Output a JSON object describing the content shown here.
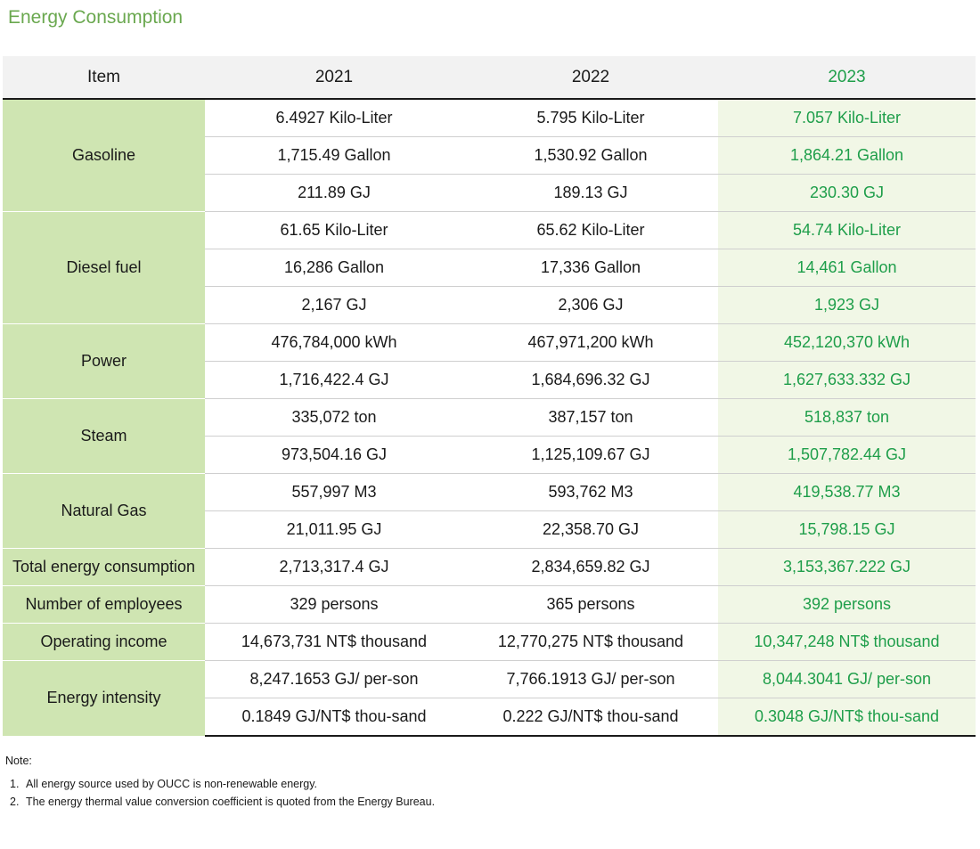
{
  "title": "Energy Consumption",
  "colors": {
    "title": "#6aa84f",
    "highlight_text": "#1e9e4a",
    "item_bg": "#cfe5b2",
    "highlight_bg": "#f1f7e6",
    "header_bg": "#f2f2f2"
  },
  "table": {
    "headers": [
      "Item",
      "2021",
      "2022",
      "2023"
    ],
    "groups": [
      {
        "item": "Gasoline",
        "rows": [
          [
            "6.4927 Kilo-Liter",
            "5.795 Kilo-Liter",
            "7.057 Kilo-Liter"
          ],
          [
            "1,715.49 Gallon",
            "1,530.92 Gallon",
            "1,864.21 Gallon"
          ],
          [
            "211.89 GJ",
            "189.13 GJ",
            "230.30 GJ"
          ]
        ]
      },
      {
        "item": "Diesel fuel",
        "rows": [
          [
            "61.65 Kilo-Liter",
            "65.62 Kilo-Liter",
            "54.74 Kilo-Liter"
          ],
          [
            "16,286 Gallon",
            "17,336 Gallon",
            "14,461 Gallon"
          ],
          [
            "2,167 GJ",
            "2,306 GJ",
            "1,923 GJ"
          ]
        ]
      },
      {
        "item": "Power",
        "rows": [
          [
            "476,784,000 kWh",
            "467,971,200 kWh",
            "452,120,370 kWh"
          ],
          [
            "1,716,422.4 GJ",
            "1,684,696.32 GJ",
            "1,627,633.332 GJ"
          ]
        ]
      },
      {
        "item": "Steam",
        "rows": [
          [
            "335,072 ton",
            "387,157 ton",
            "518,837 ton"
          ],
          [
            "973,504.16 GJ",
            "1,125,109.67 GJ",
            "1,507,782.44 GJ"
          ]
        ]
      },
      {
        "item": "Natural Gas",
        "rows": [
          [
            "557,997 M3",
            "593,762 M3",
            "419,538.77 M3"
          ],
          [
            "21,011.95 GJ",
            "22,358.70 GJ",
            "15,798.15 GJ"
          ]
        ]
      },
      {
        "item": "Total energy consumption",
        "rows": [
          [
            "2,713,317.4 GJ",
            "2,834,659.82 GJ",
            "3,153,367.222 GJ"
          ]
        ]
      },
      {
        "item": "Number of employees",
        "rows": [
          [
            "329 persons",
            "365 persons",
            "392 persons"
          ]
        ]
      },
      {
        "item": "Operating income",
        "rows": [
          [
            "14,673,731 NT$ thousand",
            "12,770,275 NT$ thousand",
            "10,347,248 NT$ thousand"
          ]
        ]
      },
      {
        "item": "Energy intensity",
        "rows": [
          [
            "8,247.1653 GJ/ per-son",
            "7,766.1913 GJ/ per-son",
            "8,044.3041 GJ/ per-son"
          ],
          [
            "0.1849 GJ/NT$ thou-sand",
            "0.222 GJ/NT$ thou-sand",
            "0.3048 GJ/NT$ thou-sand"
          ]
        ]
      }
    ]
  },
  "note": {
    "label": "Note:",
    "items": [
      {
        "num": "1.",
        "text": "All energy source used by OUCC is non-renewable energy."
      },
      {
        "num": "2.",
        "text": "The energy thermal value conversion coefficient is quoted from the Energy Bureau."
      }
    ]
  }
}
